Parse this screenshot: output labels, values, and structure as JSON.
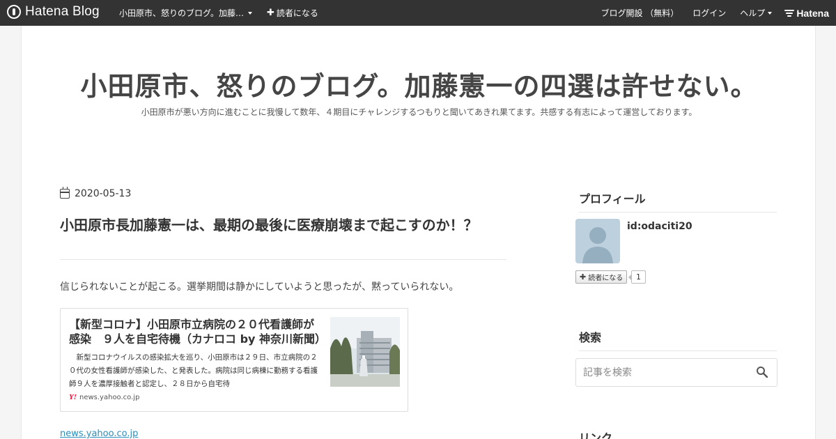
{
  "topbar": {
    "brand": "Hatena Blog",
    "blog_menu": "小田原市、怒りのブログ。加藤…",
    "subscribe": "読者になる",
    "start_blog": "ブログ開設 （無料）",
    "login": "ログイン",
    "help": "ヘルプ",
    "hatena": "Hatena"
  },
  "blog": {
    "title": "小田原市、怒りのブログ。加藤憲一の四選は許せない。",
    "description": "小田原市が悪い方向に進むことに我慢して数年、４期目にチャレンジするつもりと聞いてあきれ果てます。共感する有志によって運営しております。"
  },
  "entry": {
    "date": "2020-05-13",
    "title": "小田原市長加藤憲一は、最期の最後に医療崩壊まで起こすのか！？",
    "body": "信じられないことが起こる。選挙期間は静かにしていようと思ったが、黙っていられない。",
    "embed": {
      "title": "【新型コロナ】小田原市立病院の２０代看護師が感染　９人を自宅待機（カナロコ by 神奈川新聞）",
      "description": "新型コロナウイルスの感染拡大を巡り、小田原市は２９日、市立病院の２０代の女性看護師が感染した、と発表した。病院は同じ病棟に勤務する看護師９人を濃厚接触者と認定し、２８日から自宅待",
      "source": "news.yahoo.co.jp"
    },
    "link": "news.yahoo.co.jp"
  },
  "sidebar": {
    "profile_heading": "プロフィール",
    "profile_id": "id:odaciti20",
    "subscribe_label": "読者になる",
    "subscriber_count": "1",
    "search_heading": "検索",
    "search_placeholder": "記事を検索",
    "links_heading": "リンク"
  },
  "icons": {
    "brand": "hatena-blog-logo-icon",
    "date": "calendar-icon",
    "search": "search-icon",
    "avatar": "user-silhouette-icon"
  },
  "colors": {
    "topbar_bg": "#333333",
    "link": "#2a8fbd",
    "yahoo": "#ff0033",
    "avatar_bg": "#bcd0dd"
  }
}
